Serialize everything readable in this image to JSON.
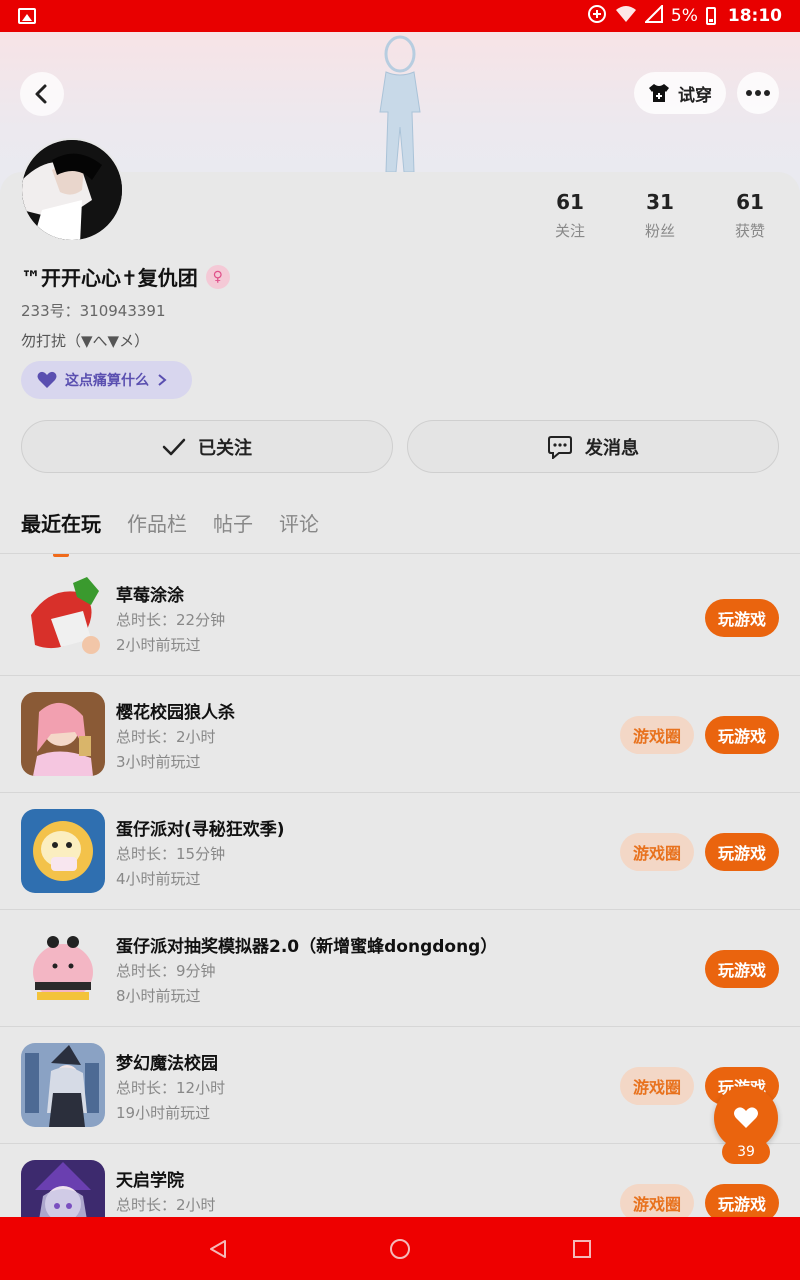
{
  "status_bar": {
    "battery": "5%",
    "time": "18:10"
  },
  "header": {
    "try_on_label": "试穿"
  },
  "profile": {
    "stats": [
      {
        "num": "61",
        "label": "关注"
      },
      {
        "num": "31",
        "label": "粉丝"
      },
      {
        "num": "61",
        "label": "获赞"
      }
    ],
    "nickname": "™开开心心✝复仇团",
    "uid": "233号：310943391",
    "bio": "勿打扰（▼へ▼メ）",
    "tag": "这点痛算什么",
    "follow_label": "已关注",
    "message_label": "发消息"
  },
  "tabs": [
    "最近在玩",
    "作品栏",
    "帖子",
    "评论"
  ],
  "labels": {
    "circle": "游戏圈",
    "play": "玩游戏"
  },
  "games": [
    {
      "title": "草莓涂涂",
      "duration": "总时长：22分钟",
      "last": "2小时前玩过",
      "has_circle": false
    },
    {
      "title": "樱花校园狼人杀",
      "duration": "总时长：2小时",
      "last": "3小时前玩过",
      "has_circle": true
    },
    {
      "title": "蛋仔派对(寻秘狂欢季)",
      "duration": "总时长：15分钟",
      "last": "4小时前玩过",
      "has_circle": true
    },
    {
      "title": "蛋仔派对抽奖模拟器2.0（新增蜜蜂dongdong）",
      "duration": "总时长：9分钟",
      "last": "8小时前玩过",
      "has_circle": false
    },
    {
      "title": "梦幻魔法校园",
      "duration": "总时长：12小时",
      "last": "19小时前玩过",
      "has_circle": true
    },
    {
      "title": "天启学院",
      "duration": "总时长：2小时",
      "last": "",
      "has_circle": true
    }
  ],
  "like_count": "39",
  "colors": {
    "accent": "#ea640e",
    "status_bar": "#e80000",
    "nav_bar": "#ee0000"
  }
}
